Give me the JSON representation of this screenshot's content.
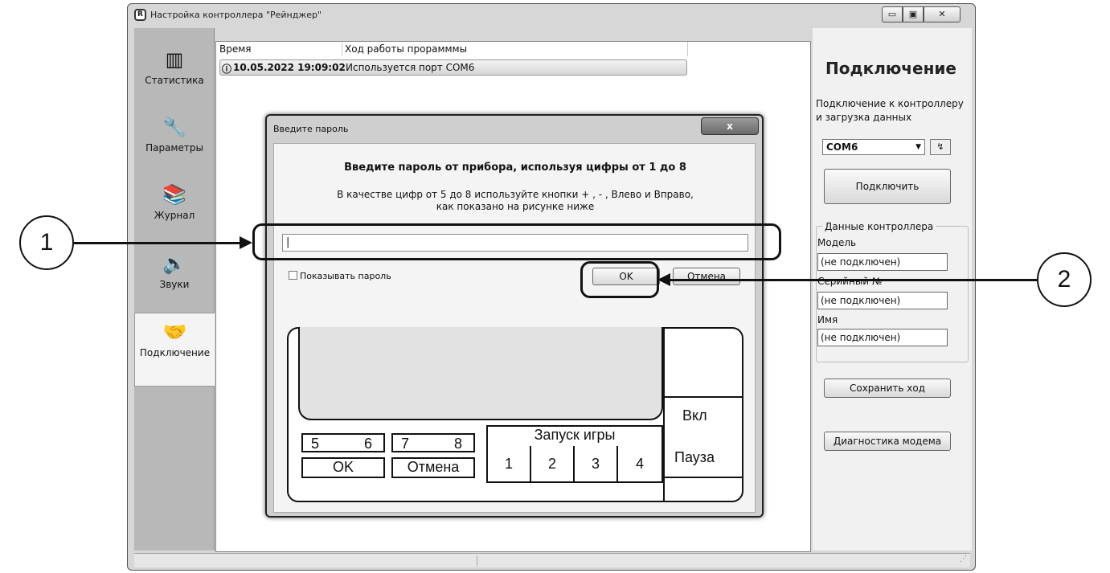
{
  "window": {
    "title": "Настройка контроллера \"Рейнджер\"",
    "app_icon": "R",
    "minimize_glyph": "▭",
    "maximize_glyph": "▣",
    "close_glyph": "✕"
  },
  "nav": {
    "items": [
      {
        "label": "Статистика",
        "icon": "chart-icon",
        "glyph": "▥"
      },
      {
        "label": "Параметры",
        "icon": "wrench-icon",
        "glyph": "🔧"
      },
      {
        "label": "Журнал",
        "icon": "journal-icon",
        "glyph": "📚"
      },
      {
        "label": "Звуки",
        "icon": "speaker-icon",
        "glyph": "🔊"
      },
      {
        "label": "Подключение",
        "icon": "handshake-icon",
        "glyph": "🤝",
        "active": true
      }
    ]
  },
  "log": {
    "columns": [
      "Время",
      "Ход работы прорамммы"
    ],
    "rows": [
      {
        "time": "10.05.2022 19:09:02",
        "message": "Используется порт COM6"
      }
    ]
  },
  "right_panel": {
    "title": "Подключение",
    "description": "Подключение к контроллеру и загрузка данных",
    "port_value": "COM6",
    "connect_label": "Подключить",
    "group_title": "Данные контроллера",
    "fields": [
      {
        "label": "Модель",
        "value": "(не подключен)"
      },
      {
        "label": "Серийный №",
        "value": "(не подключен)"
      },
      {
        "label": "Имя",
        "value": "(не подключен)"
      }
    ],
    "save_label": "Сохранить ход",
    "diag_label": "Диагностика модема"
  },
  "dialog": {
    "title": "Введите пароль",
    "close_glyph": "x",
    "heading": "Введите пароль от прибора, используя цифры от 1 до 8",
    "hint_line1": "В качестве цифр от 5 до 8 используйте кнопки + , - , Влево и Вправо,",
    "hint_line2": "как показано на рисунке ниже",
    "password_value": "|",
    "show_password_label": "Показывать пароль",
    "ok_label": "OK",
    "cancel_label": "Отмена"
  },
  "device": {
    "key_5": "5",
    "key_6": "6",
    "key_7": "7",
    "key_8": "8",
    "ok": "OK",
    "cancel": "Отмена",
    "start_game": "Запуск игры",
    "key_1": "1",
    "key_2": "2",
    "key_3": "3",
    "key_4": "4",
    "on": "Вкл",
    "pause": "Пауза"
  },
  "callouts": [
    "1",
    "2"
  ]
}
